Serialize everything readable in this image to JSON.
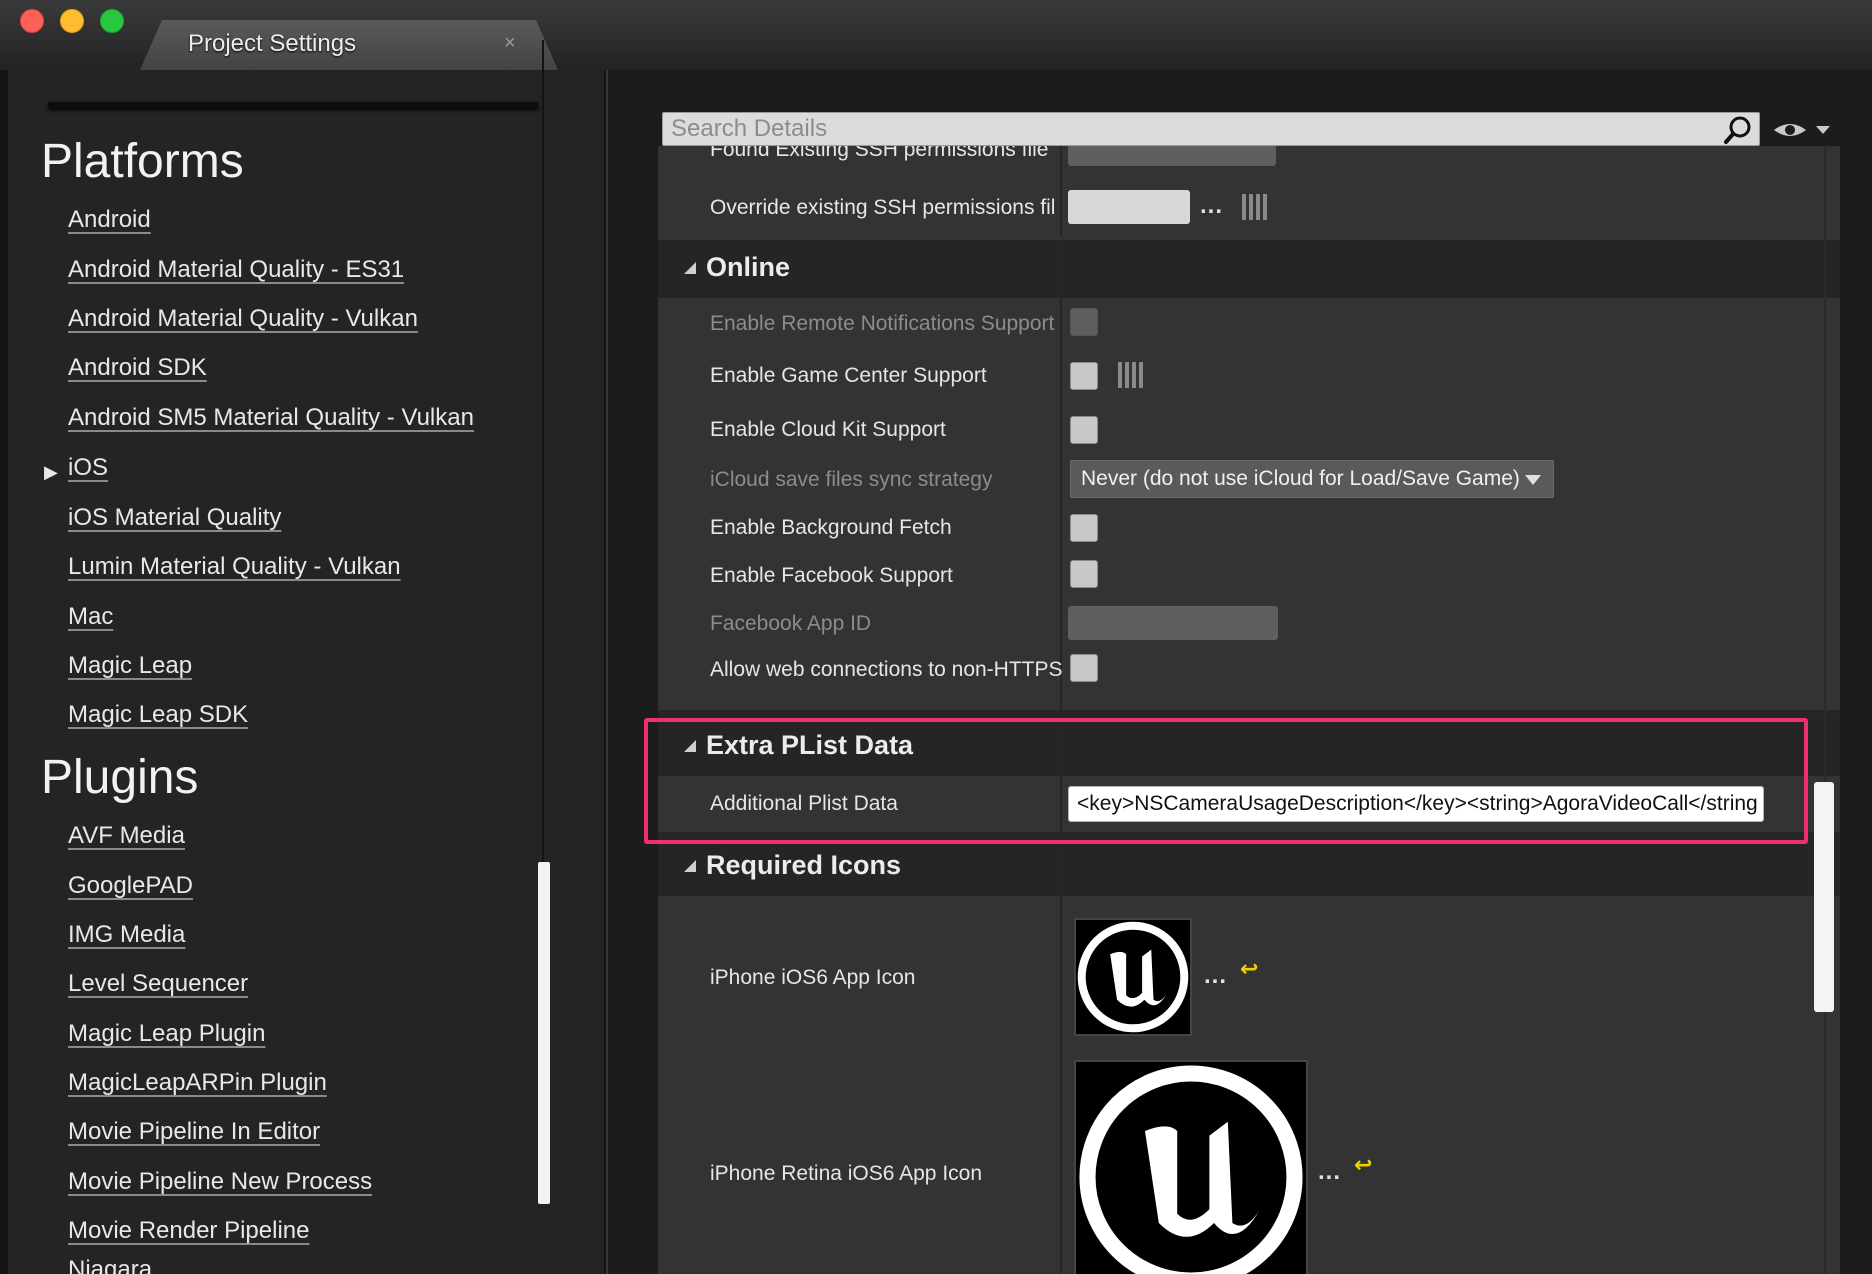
{
  "window": {
    "tab_title": "Project Settings",
    "tab_close": "×"
  },
  "sidebar": {
    "categories": [
      {
        "title": "Platforms",
        "items": [
          {
            "label": "Android"
          },
          {
            "label": "Android Material Quality - ES31"
          },
          {
            "label": "Android Material Quality - Vulkan"
          },
          {
            "label": "Android SDK"
          },
          {
            "label": "Android SM5 Material Quality - Vulkan"
          },
          {
            "label": "iOS",
            "expandable": true
          },
          {
            "label": "iOS Material Quality"
          },
          {
            "label": "Lumin Material Quality - Vulkan"
          },
          {
            "label": "Mac"
          },
          {
            "label": "Magic Leap"
          },
          {
            "label": "Magic Leap SDK"
          }
        ]
      },
      {
        "title": "Plugins",
        "items": [
          {
            "label": "AVF Media"
          },
          {
            "label": "GooglePAD"
          },
          {
            "label": "IMG Media"
          },
          {
            "label": "Level Sequencer"
          },
          {
            "label": "Magic Leap Plugin"
          },
          {
            "label": "MagicLeapARPin Plugin"
          },
          {
            "label": "Movie Pipeline In Editor"
          },
          {
            "label": "Movie Pipeline New Process"
          },
          {
            "label": "Movie Render Pipeline"
          },
          {
            "label": "Niagara"
          }
        ]
      }
    ],
    "expand_arrow": "▶"
  },
  "details": {
    "search": {
      "placeholder": "Search Details",
      "value": ""
    },
    "ssh": {
      "found_label": "Found Existing SSH permissions file",
      "override_label": "Override existing SSH permissions fil",
      "browse_label": "..."
    },
    "online": {
      "title": "Online",
      "remote_notifications": "Enable Remote Notifications Support",
      "game_center": "Enable Game Center Support",
      "cloud_kit": "Enable Cloud Kit Support",
      "icloud_strategy_label": "iCloud save files sync strategy",
      "icloud_strategy_value": "Never (do not use iCloud for Load/Save Game)",
      "background_fetch": "Enable Background Fetch",
      "facebook_support": "Enable Facebook Support",
      "facebook_app_id": "Facebook App ID",
      "web_connections": "Allow web connections to non-HTTPS"
    },
    "plist": {
      "title": "Extra PList Data",
      "label": "Additional Plist Data",
      "value": "<key>NSCameraUsageDescription</key><string>AgoraVideoCall</string"
    },
    "icons": {
      "title": "Required Icons",
      "iphone_ios6": "iPhone iOS6 App Icon",
      "iphone_retina_ios6": "iPhone Retina iOS6 App Icon",
      "browse_label": "...",
      "reset_label": "↩"
    }
  },
  "colors": {
    "highlight": "#f0306a",
    "reset_arrow": "#f0d000",
    "panel_bg": "#333333",
    "section_bg": "#252525"
  }
}
